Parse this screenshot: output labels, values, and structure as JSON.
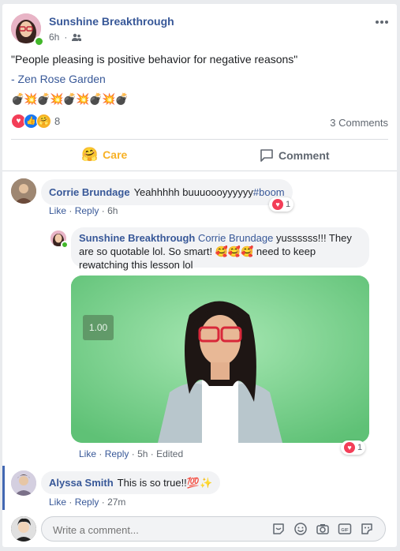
{
  "post": {
    "author": "Sunshine Breakthrough",
    "time": "6h",
    "quote": "\"People pleasing is positive behavior for negative reasons\"",
    "source": "- Zen Rose Garden",
    "emoji_line": "💣💥💣💥💣💥💣💥💣",
    "reaction_count": "8",
    "comments_count": "3 Comments",
    "care_label": "Care",
    "comment_label": "Comment"
  },
  "comments": [
    {
      "author": "Corrie Brundage",
      "text": "Yeahhhhh buuuoooyyyyyy ",
      "hashtag": "#boom",
      "like": "Like",
      "reply": "Reply",
      "time": "6h",
      "reactions": "1"
    }
  ],
  "reply": {
    "author": "Sunshine Breakthrough",
    "mention": "Corrie Brundage",
    "text1": " yussssss!!! They are so quotable lol. So smart! 🥰🥰🥰 need to keep rewatching this lesson lol",
    "gif_counter": "1.00",
    "like": "Like",
    "reply": "Reply",
    "time": "5h",
    "edited": "Edited",
    "reactions": "1"
  },
  "comment2": {
    "author": "Alyssa Smith",
    "text": "This is so true!!💯✨",
    "like": "Like",
    "reply": "Reply",
    "time": "27m"
  },
  "composer": {
    "placeholder": "Write a comment..."
  },
  "colors": {
    "link": "#385898",
    "care": "#f7b125",
    "gif_bg": "#7fd38e"
  }
}
